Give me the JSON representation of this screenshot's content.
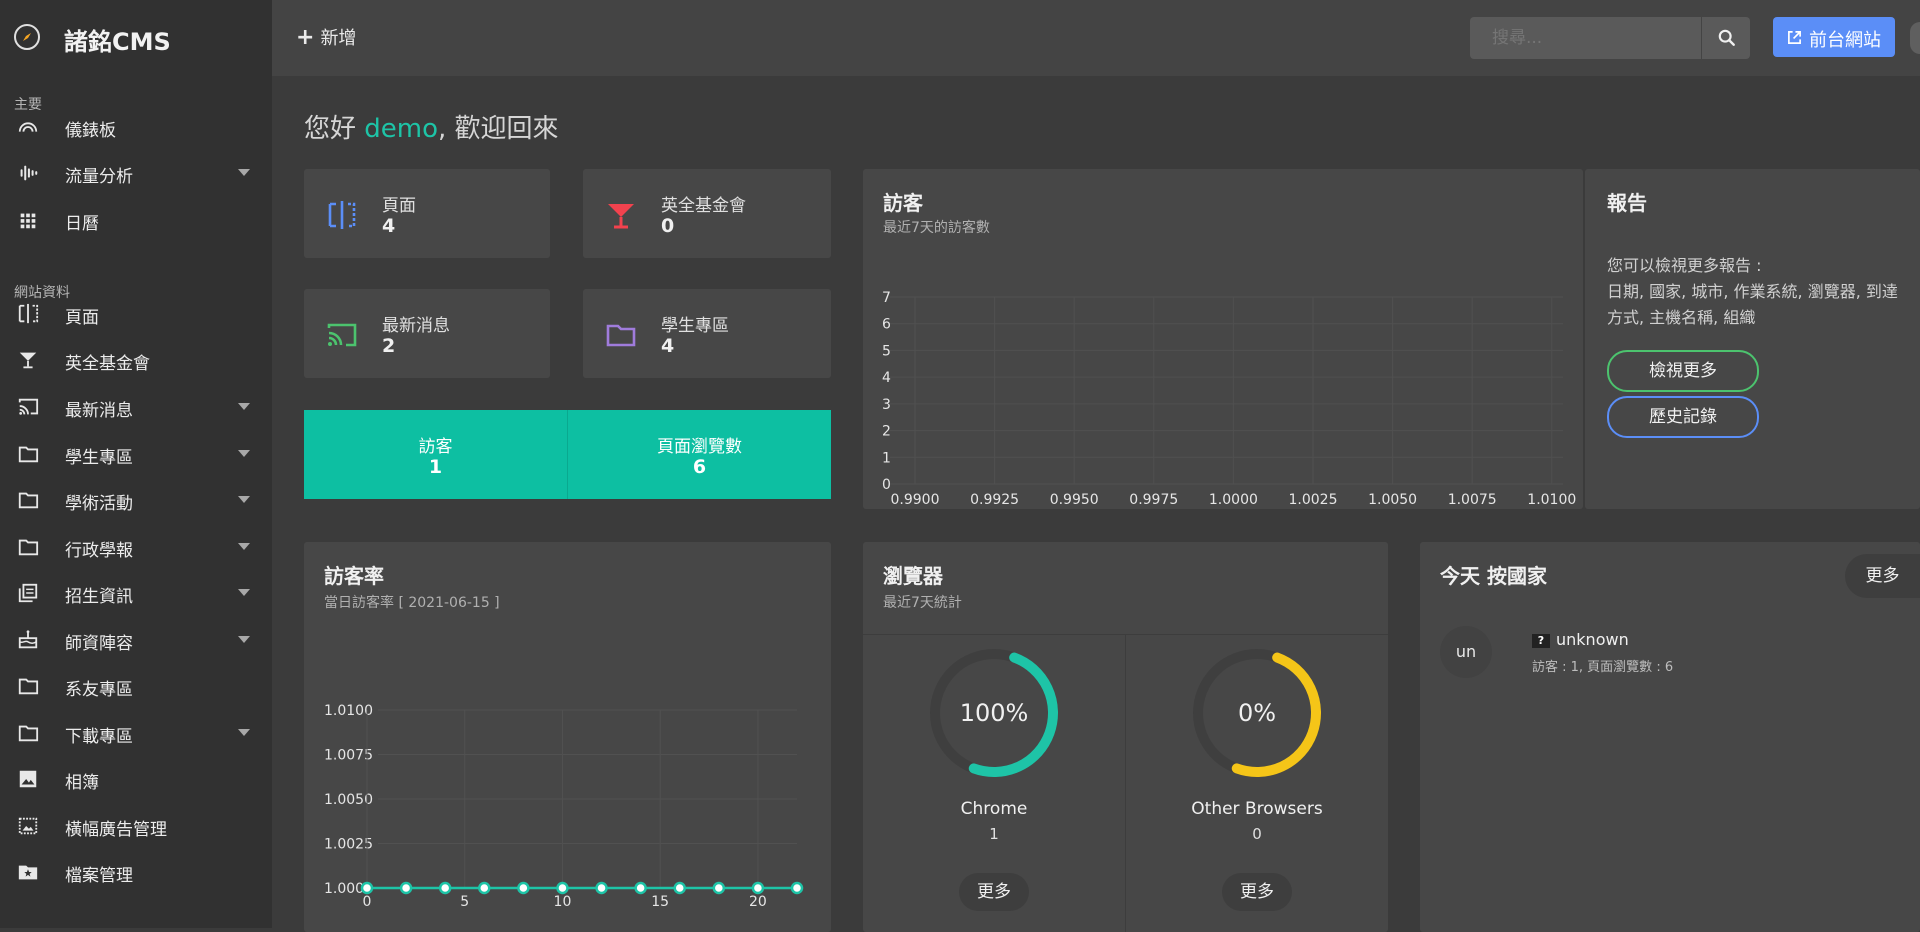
{
  "app": {
    "title": "諸銘CMS"
  },
  "sidebar": {
    "sections": [
      "主要",
      "網站資料"
    ],
    "items": [
      {
        "label": "儀錶板",
        "icon": "dashboard-gauge-icon",
        "sub": false
      },
      {
        "label": "流量分析",
        "icon": "audio-wave-icon",
        "sub": true
      },
      {
        "label": "日曆",
        "icon": "calendar-grid-icon",
        "sub": false
      },
      {
        "label": "頁面",
        "icon": "page-split-icon",
        "sub": false
      },
      {
        "label": "英全基金會",
        "icon": "cocktail-glass-icon",
        "sub": false
      },
      {
        "label": "最新消息",
        "icon": "cast-icon",
        "sub": true
      },
      {
        "label": "學生專區",
        "icon": "folder-icon",
        "sub": true
      },
      {
        "label": "學術活動",
        "icon": "folder-icon",
        "sub": true
      },
      {
        "label": "行政學報",
        "icon": "folder-icon",
        "sub": true
      },
      {
        "label": "招生資訊",
        "icon": "library-books-icon",
        "sub": true
      },
      {
        "label": "師資陣容",
        "icon": "cake-icon",
        "sub": true
      },
      {
        "label": "系友專區",
        "icon": "folder-icon",
        "sub": false
      },
      {
        "label": "下載專區",
        "icon": "folder-icon",
        "sub": true
      },
      {
        "label": "相簿",
        "icon": "image-icon",
        "sub": false
      },
      {
        "label": "橫幅廣告管理",
        "icon": "banner-image-icon",
        "sub": false
      },
      {
        "label": "檔案管理",
        "icon": "folder-star-icon",
        "sub": false
      }
    ]
  },
  "topbar": {
    "add_label": "新增",
    "search_placeholder": "搜尋...",
    "front_label": "前台網站"
  },
  "greeting": {
    "prefix": "您好",
    "user": "demo",
    "suffix": ", 歡迎回來"
  },
  "stats": [
    {
      "label": "頁面",
      "value": "4",
      "icon": "page-split-icon",
      "color": "#5b8ef7"
    },
    {
      "label": "英全基金會",
      "value": "0",
      "icon": "cocktail-glass-icon",
      "color": "#f2424e"
    },
    {
      "label": "最新消息",
      "value": "2",
      "icon": "cast-icon",
      "color": "#4cc36e"
    },
    {
      "label": "學生專區",
      "value": "4",
      "icon": "folder-icon",
      "color": "#a07cdc"
    }
  ],
  "summary": [
    {
      "label": "訪客",
      "value": "1"
    },
    {
      "label": "頁面瀏覽數",
      "value": "6"
    }
  ],
  "visitors_card": {
    "title": "訪客",
    "subtitle": "最近7天的訪客數"
  },
  "reports_card": {
    "title": "報告",
    "line1": "您可以檢視更多報告 :",
    "line2": "日期, 國家, 城市, 作業系統, 瀏覽器, 到達",
    "line3": "方式, 主機名稱, 組織",
    "btn_more": "檢視更多",
    "btn_history": "歷史記錄"
  },
  "rate_card": {
    "title": "訪客率",
    "subtitle": "當日訪客率 [ 2021-06-15 ]"
  },
  "browser_card": {
    "title": "瀏覽器",
    "subtitle": "最近7天統計",
    "items": [
      {
        "name": "Chrome",
        "count": "1",
        "percent": "100%",
        "fraction": 1.0,
        "color": "#1ec4a7",
        "more": "更多"
      },
      {
        "name": "Other Browsers",
        "count": "0",
        "percent": "0%",
        "fraction": 0.0,
        "color": "#f5c518",
        "more": "更多"
      }
    ]
  },
  "country_card": {
    "title": "今天 按國家",
    "more": "更多",
    "items": [
      {
        "code": "un",
        "name": "unknown",
        "flag": "?",
        "stats": "訪客 : 1, 頁面瀏覽數 : 6"
      }
    ]
  },
  "chart_data": [
    {
      "type": "bar",
      "title": "訪客",
      "subtitle": "最近7天的訪客數",
      "x_ticks": [
        "0.9900",
        "0.9925",
        "0.9950",
        "0.9975",
        "1.0000",
        "1.0025",
        "1.0050",
        "1.0075",
        "1.0100"
      ],
      "y_ticks": [
        "0",
        "1",
        "2",
        "3",
        "4",
        "5",
        "6",
        "7"
      ],
      "ylim": [
        0,
        7
      ],
      "series": [],
      "grid": true
    },
    {
      "type": "line",
      "title": "訪客率",
      "subtitle": "當日訪客率 [ 2021-06-15 ]",
      "x_ticks": [
        "0",
        "5",
        "10",
        "15",
        "20"
      ],
      "y_ticks": [
        "1.0000",
        "1.0025",
        "1.0050",
        "1.0075",
        "1.0100"
      ],
      "xlim": [
        0,
        22
      ],
      "ylim": [
        1.0,
        1.01
      ],
      "series": [
        {
          "x": [
            0,
            2,
            4,
            6,
            8,
            10,
            12,
            14,
            16,
            18,
            20,
            22
          ],
          "y": [
            1,
            1,
            1,
            1,
            1,
            1,
            1,
            1,
            1,
            1,
            1,
            1
          ],
          "color": "#1ec4a7"
        }
      ],
      "grid": true
    }
  ]
}
